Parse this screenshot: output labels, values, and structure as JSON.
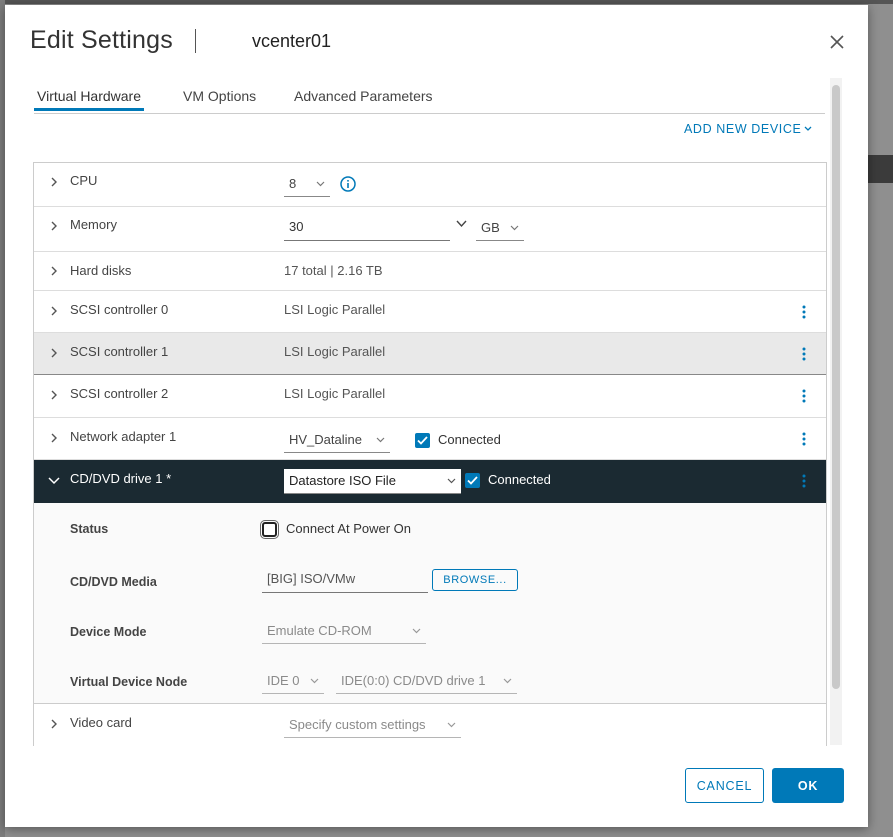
{
  "dialog": {
    "title": "Edit Settings",
    "vm_name": "vcenter01"
  },
  "tabs": [
    {
      "label": "Virtual Hardware",
      "active": true
    },
    {
      "label": "VM Options",
      "active": false
    },
    {
      "label": "Advanced Parameters",
      "active": false
    }
  ],
  "add_new_device": "ADD NEW DEVICE",
  "hardware": {
    "cpu": {
      "label": "CPU",
      "value": "8"
    },
    "memory": {
      "label": "Memory",
      "value": "30",
      "unit": "GB"
    },
    "hard_disks": {
      "label": "Hard disks",
      "value": "17 total | 2.16 TB"
    },
    "scsi0": {
      "label": "SCSI controller 0",
      "value": "LSI Logic Parallel"
    },
    "scsi1": {
      "label": "SCSI controller 1",
      "value": "LSI Logic Parallel"
    },
    "scsi2": {
      "label": "SCSI controller 2",
      "value": "LSI Logic Parallel"
    },
    "network": {
      "label": "Network adapter 1",
      "value": "HV_Dataline",
      "connected_label": "Connected",
      "connected": true
    },
    "cddvd": {
      "label": "CD/DVD drive 1 *",
      "value": "Datastore ISO File",
      "connected_label": "Connected",
      "connected": true,
      "status_label": "Status",
      "connect_power_on_label": "Connect At Power On",
      "connect_power_on": false,
      "media_label": "CD/DVD Media",
      "media_value": "[BIG] ISO/VMw",
      "browse_label": "BROWSE...",
      "device_mode_label": "Device Mode",
      "device_mode_value": "Emulate CD-ROM",
      "node_label": "Virtual Device Node",
      "node_bus": "IDE 0",
      "node_device": "IDE(0:0) CD/DVD drive 1"
    },
    "video": {
      "label": "Video card",
      "value": "Specify custom settings"
    }
  },
  "footer": {
    "cancel": "CANCEL",
    "ok": "OK"
  },
  "colors": {
    "accent": "#0079b8",
    "expanded_row_bg": "#1b2a32"
  }
}
